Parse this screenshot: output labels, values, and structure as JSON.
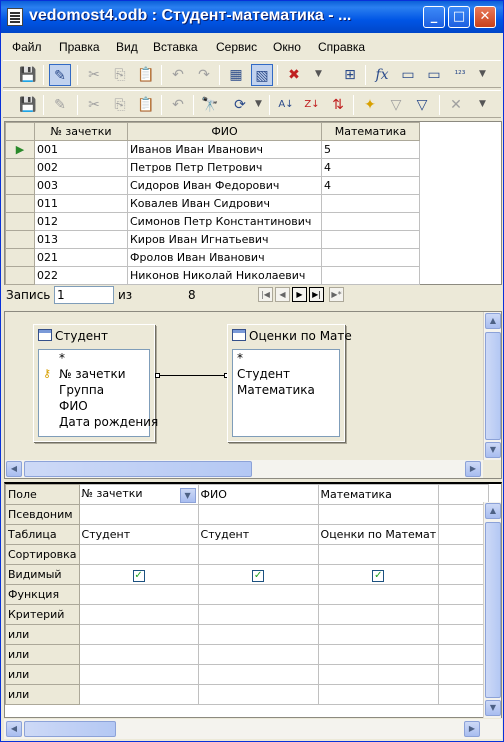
{
  "window": {
    "title": "vedomost4.odb : Студент-математика - ...",
    "min_glyph": "_",
    "max_glyph": "□",
    "close_glyph": "✕"
  },
  "menu": [
    "Файл",
    "Правка",
    "Вид",
    "Вставка",
    "Сервис",
    "Окно",
    "Справка"
  ],
  "toolbar1": [
    {
      "name": "save-icon",
      "glyph": "💾"
    },
    {
      "name": "edit-icon",
      "glyph": "✎"
    },
    {
      "name": "cut-icon",
      "glyph": "✂"
    },
    {
      "name": "copy-icon",
      "glyph": "⎘"
    },
    {
      "name": "paste-icon",
      "glyph": "📋"
    },
    {
      "name": "undo-icon",
      "glyph": "↶"
    },
    {
      "name": "redo-icon",
      "glyph": "↷"
    },
    {
      "name": "run-query-icon",
      "glyph": "▦"
    },
    {
      "name": "design-view-icon",
      "glyph": "▧"
    },
    {
      "name": "clear-query-icon",
      "glyph": "✖"
    },
    {
      "name": "add-table-icon",
      "glyph": "⊞"
    },
    {
      "name": "function-icon",
      "glyph": "fx"
    },
    {
      "name": "table-name-icon",
      "glyph": "▭"
    },
    {
      "name": "alias-icon",
      "glyph": "▭"
    },
    {
      "name": "distinct-values-icon",
      "glyph": "¹²³"
    }
  ],
  "toolbar2": [
    {
      "name": "save-record-icon",
      "glyph": "💾"
    },
    {
      "name": "edit-data-icon",
      "glyph": "✎"
    },
    {
      "name": "cut-data-icon",
      "glyph": "✂"
    },
    {
      "name": "copy-data-icon",
      "glyph": "⎘"
    },
    {
      "name": "paste-data-icon",
      "glyph": "📋"
    },
    {
      "name": "undo-data-icon",
      "glyph": "↶"
    },
    {
      "name": "find-record-icon",
      "glyph": "🔭"
    },
    {
      "name": "refresh-icon",
      "glyph": "⟳"
    },
    {
      "name": "sort-asc-icon",
      "glyph": "A↓"
    },
    {
      "name": "sort-desc-icon",
      "glyph": "Z↓"
    },
    {
      "name": "sort-icon",
      "glyph": "⇅"
    },
    {
      "name": "autofilter-icon",
      "glyph": "✦"
    },
    {
      "name": "standard-filter-icon",
      "glyph": "▽"
    },
    {
      "name": "apply-filter-icon",
      "glyph": "▽"
    },
    {
      "name": "remove-filter-icon",
      "glyph": "✕"
    }
  ],
  "grid": {
    "headers": [
      "№ зачетки",
      "ФИО",
      "Математика"
    ],
    "rows": [
      [
        "001",
        "Иванов Иван Иванович",
        "5"
      ],
      [
        "002",
        "Петров Петр Петрович",
        "4"
      ],
      [
        "003",
        "Сидоров Иван Федорович",
        "4"
      ],
      [
        "011",
        "Ковалев Иван Сидрович",
        ""
      ],
      [
        "012",
        "Симонов Петр Константинович",
        ""
      ],
      [
        "013",
        "Киров Иван Игнатьевич",
        ""
      ],
      [
        "021",
        "Фролов Иван Иванович",
        ""
      ],
      [
        "022",
        "Никонов Николай Николаевич",
        ""
      ]
    ],
    "current_row_marker": "▶"
  },
  "navigation": {
    "record_label": "Запись",
    "record_value": "1",
    "of_label": "из",
    "total": "8"
  },
  "relation": {
    "table1": {
      "title": "Студент",
      "fields": [
        "*",
        "№ зачетки",
        "Группа",
        "ФИО",
        "Дата рождения"
      ]
    },
    "table2": {
      "title": "Оценки по Мате",
      "fields": [
        "*",
        "Студент",
        "Математика"
      ]
    }
  },
  "criteria": {
    "row_labels": [
      "Поле",
      "Псевдоним",
      "Таблица",
      "Сортировка",
      "Видимый",
      "Функция",
      "Критерий",
      "или",
      "или",
      "или",
      "или"
    ],
    "columns": [
      {
        "field": "№ зачетки",
        "table": "Студент",
        "visible": true
      },
      {
        "field": "ФИО",
        "table": "Студент",
        "visible": true
      },
      {
        "field": "Математика",
        "table": "Оценки по Математ",
        "visible": true
      }
    ]
  }
}
